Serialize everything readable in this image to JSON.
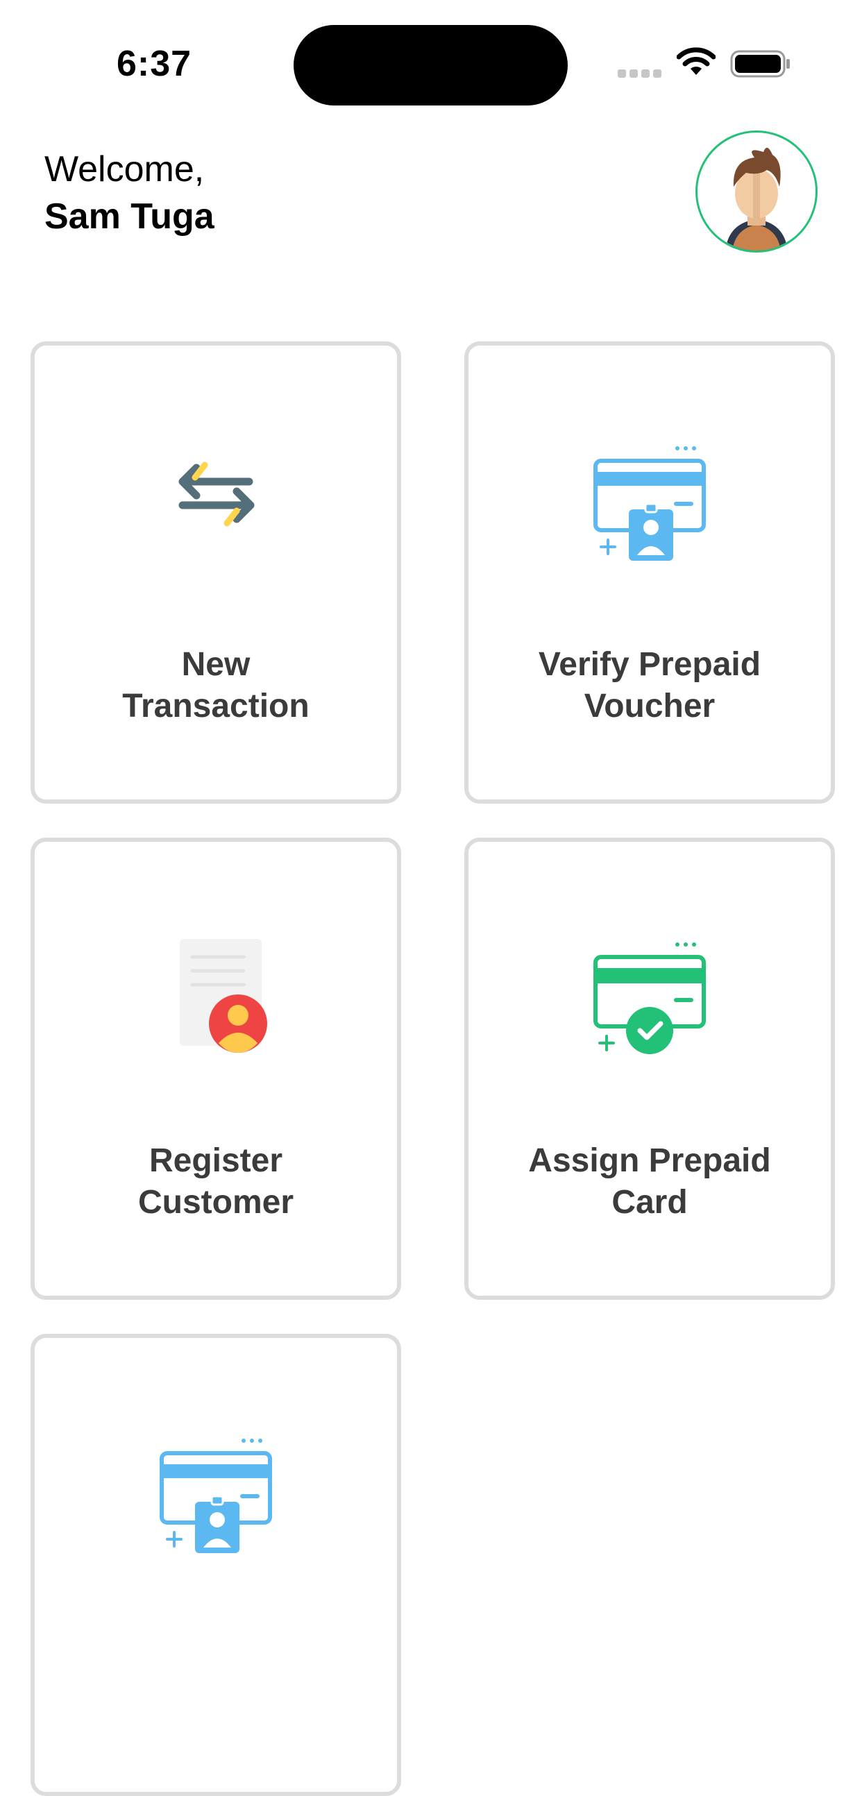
{
  "status_bar": {
    "time": "6:37"
  },
  "header": {
    "greeting": "Welcome,",
    "user_name": "Sam Tuga"
  },
  "colors": {
    "accent_green": "#23C178",
    "accent_blue": "#5BB8F0",
    "arrow_gray": "#546E7A",
    "arrow_yellow": "#FFD54F",
    "user_red": "#EF4444",
    "card_border": "#DCDCDC"
  },
  "actions": [
    {
      "label_line1": "New",
      "label_line2": "Transaction",
      "icon": "exchange-arrows-icon"
    },
    {
      "label_line1": "Verify Prepaid",
      "label_line2": "Voucher",
      "icon": "prepaid-card-badge-icon"
    },
    {
      "label_line1": "Register",
      "label_line2": "Customer",
      "icon": "register-customer-icon"
    },
    {
      "label_line1": "Assign Prepaid",
      "label_line2": "Card",
      "icon": "card-check-icon"
    },
    {
      "label_line1": "",
      "label_line2": "",
      "icon": "prepaid-card-badge-icon"
    }
  ]
}
